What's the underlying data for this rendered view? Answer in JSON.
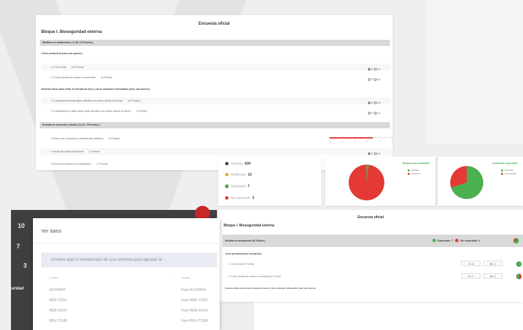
{
  "survey": {
    "title": "Encuesta oficial",
    "bloque": "Bloque I. Bioseguridad externa",
    "sections": [
      {
        "label": "Medidas de aislamiento      [ 1)   98 / 20 Puntos ]"
      },
      {
        "label": "Entrada de personal y visitas      [ 2)   15 / 15 Puntos ]"
      }
    ],
    "sub1": "Cierre perimetral (solo una opcion)",
    "rows1": [
      {
        "text": "1.1 Cierre total",
        "pts": "(10 Puntos)"
      },
      {
        "text": "1.2 Cierre parcial con acceso no controlado",
        "pts": "(4 Puntos)"
      }
    ],
    "sub2": "Sistema eficaz para evitar la entrada de aves y otros animales indeseables (solo una opcion)",
    "rows2": [
      {
        "text": "2.1 Instalaciones donde dejan animales con acceso directo al exterior",
        "pts": "(10 Puntos)"
      },
      {
        "text": "2.2 Instalaciones y valles donde dejan animales con acceso directo al exterior",
        "pts": "(0 Puntos)"
      }
    ],
    "rows3": [
      {
        "text": "3 Acceso con el personal y sistemas bien definidos",
        "pts": "(4 Puntos)"
      },
      {
        "text": "4 Lavado de ropas del personal",
        "pts": "(1 Puntos)"
      },
      {
        "text": "5 Ducha en el acceso de la explotacion",
        "pts": "(1 Puntos)"
      }
    ],
    "radio_yes": "Si",
    "radio_no": "No",
    "slider_ticks": [
      "0",
      "1",
      "2",
      "3",
      "4",
      "5"
    ],
    "slider_value": 0.68
  },
  "stats": {
    "items": [
      {
        "label": "Granjas",
        "value": "639",
        "color": "#444444"
      },
      {
        "label": "Auditorias",
        "value": "10",
        "color": "#f5a623"
      },
      {
        "label": "Superado",
        "value": "7",
        "color": "#4caf50"
      },
      {
        "label": "No superado",
        "value": "3",
        "color": "#e53935"
      }
    ]
  },
  "pies": [
    {
      "title": "Bloques aun auditados",
      "legend": [
        "Auditado",
        "Pendiente"
      ],
      "green": 0.02
    },
    {
      "title": "Auditorias superadas",
      "legend": [
        "Superado",
        "No superado"
      ],
      "green": 0.7
    }
  ],
  "survey2": {
    "title": "Encuesta oficial",
    "bloque": "Bloque I. Bioseguridad externa",
    "bar_label": "Medidas de aislamiento      (20 Puntos )",
    "superado": "Superado: 7",
    "no_superado": "No superado: 3",
    "sub": "Cierre perimetral (solo una opcion)",
    "rows": [
      {
        "text": "1.1 Cierre total      (10 Puntos)",
        "si": "Si: 6",
        "no": "No: 1"
      },
      {
        "text": "1.2 Cierre parcial con acceso no controlado      (4 Puntos)",
        "si": "Si: 1",
        "no": "No: 1"
      }
    ],
    "sub2": "Sistema eficaz para evitar la entrada de aves y otros animales indeseables (solo una opcion)"
  },
  "dialog": {
    "title": "Ver datos",
    "group_hint": "Arrastre aqui el encabezado de una columna para agrupar la",
    "col1": "Codigo",
    "col2": "Granja",
    "rows": [
      {
        "code": "AZ100094",
        "farm": "Farm AZ100094"
      },
      {
        "code": "BBD-T2251",
        "farm": "Farm BBD-T2251"
      },
      {
        "code": "BEB-01014",
        "farm": "Farm BEB-01014"
      },
      {
        "code": "BBU-T1188",
        "farm": "Farm BBU-T1188"
      }
    ],
    "side_numbers": [
      "10",
      "7",
      "3"
    ],
    "side_label": "seguridad"
  }
}
